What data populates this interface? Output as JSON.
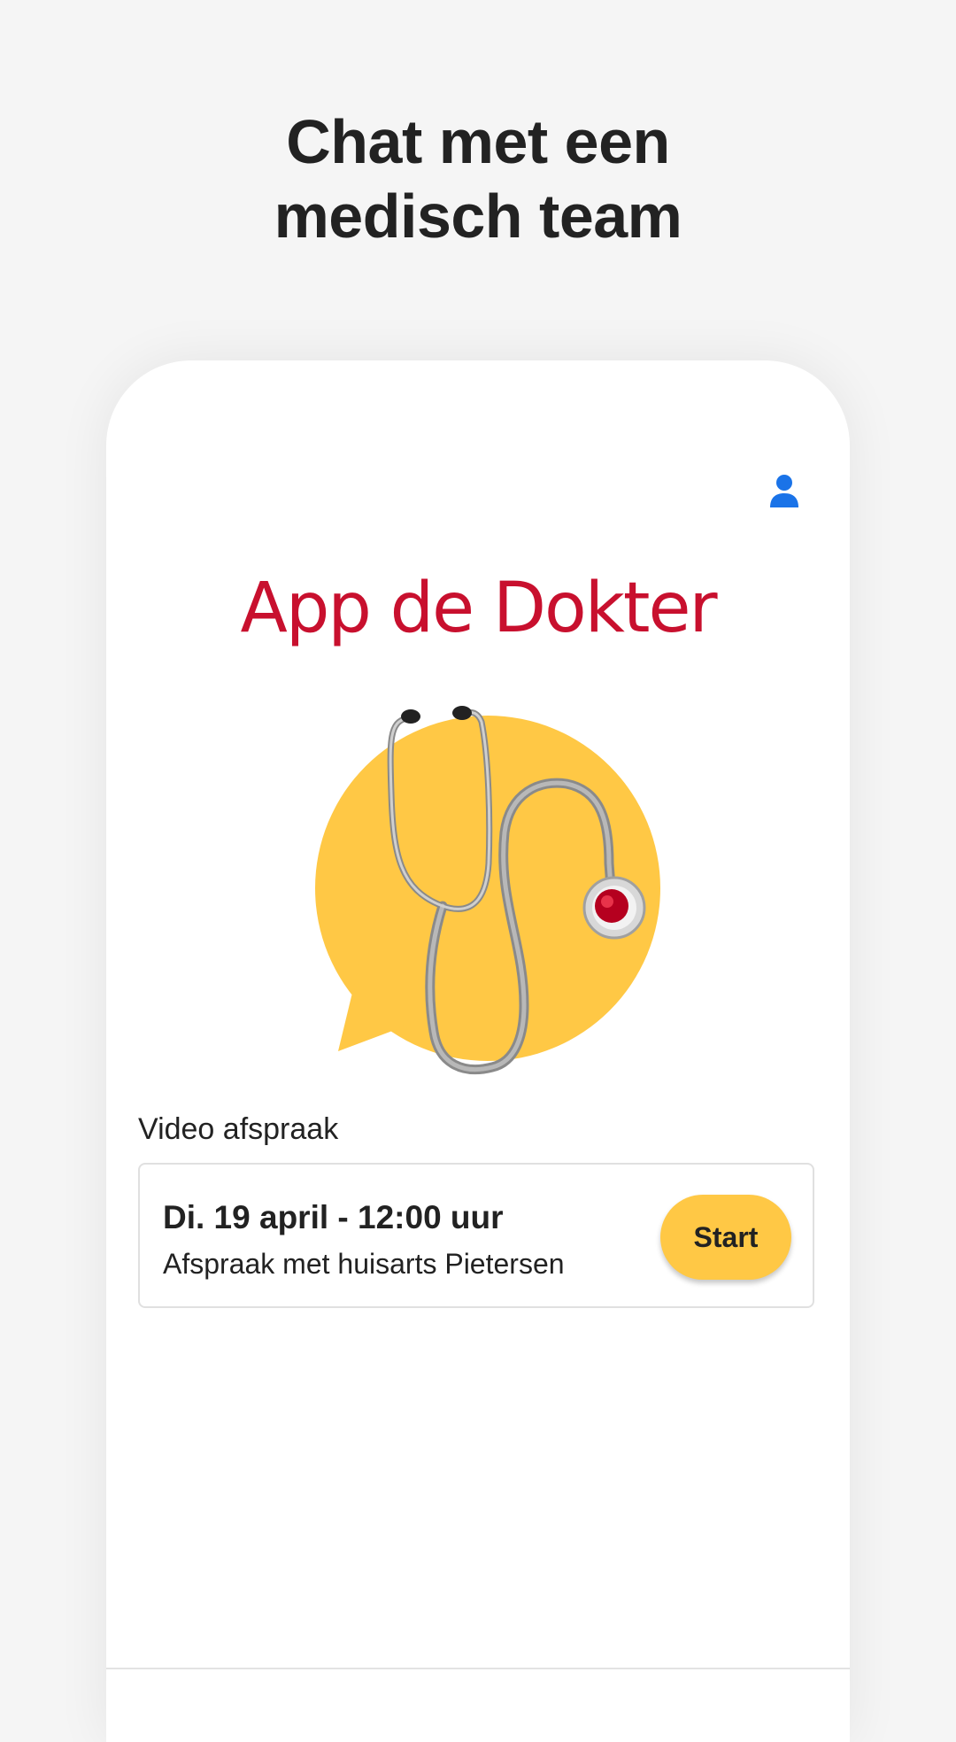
{
  "headline": {
    "line1": "Chat met een",
    "line2": "medisch team"
  },
  "app": {
    "title": "App de Dokter",
    "title_color": "#c8102e",
    "accent_color": "#ffc845",
    "profile_icon": "user-icon",
    "profile_icon_color": "#1a73e8"
  },
  "appointments": {
    "section_label": "Video afspraak",
    "items": [
      {
        "date": "Di. 19 april - 12:00 uur",
        "description": "Afspraak met huisarts Pietersen",
        "action_label": "Start"
      }
    ]
  }
}
